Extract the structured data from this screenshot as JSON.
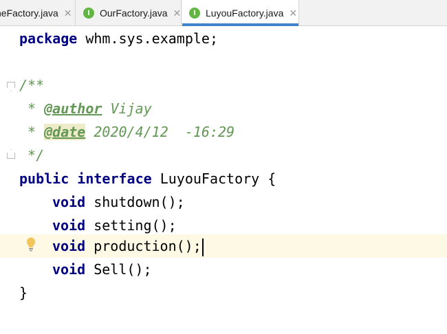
{
  "tabs": [
    {
      "label": "neFactory.java",
      "close": "✕",
      "active": false,
      "has_icon": false
    },
    {
      "label": "OurFactory.java",
      "close": "✕",
      "active": false,
      "icon_letter": "I"
    },
    {
      "label": "LuyouFactory.java",
      "close": "✕",
      "active": true,
      "icon_letter": "I"
    }
  ],
  "colors": {
    "keyword": "#000080",
    "comment": "#629755",
    "caret_line": "#fdf9e4",
    "active_tab_underline": "#4083c9",
    "interface_icon": "#62b543"
  },
  "code": {
    "line1": {
      "kw": "package",
      "rest": " whm.sys.example;"
    },
    "line3": "/**",
    "line4": {
      "prefix": " * ",
      "tag": "@author",
      "value": " Vijay"
    },
    "line5": {
      "prefix": " * ",
      "tag": "@date",
      "value": " 2020/4/12  -16:29"
    },
    "line6": " */",
    "line7": {
      "kw1": "public",
      "kw2": "interface",
      "name": " LuyouFactory {"
    },
    "methods": [
      {
        "kw": "void",
        "name": " shutdown();"
      },
      {
        "kw": "void",
        "name": " setting();"
      },
      {
        "kw": "void",
        "name": " production();"
      },
      {
        "kw": "void",
        "name": " Sell();"
      }
    ],
    "closing": "}"
  },
  "gutter_icons": [
    "fold-open-icon",
    "fold-close-icon",
    "lightbulb-icon"
  ]
}
